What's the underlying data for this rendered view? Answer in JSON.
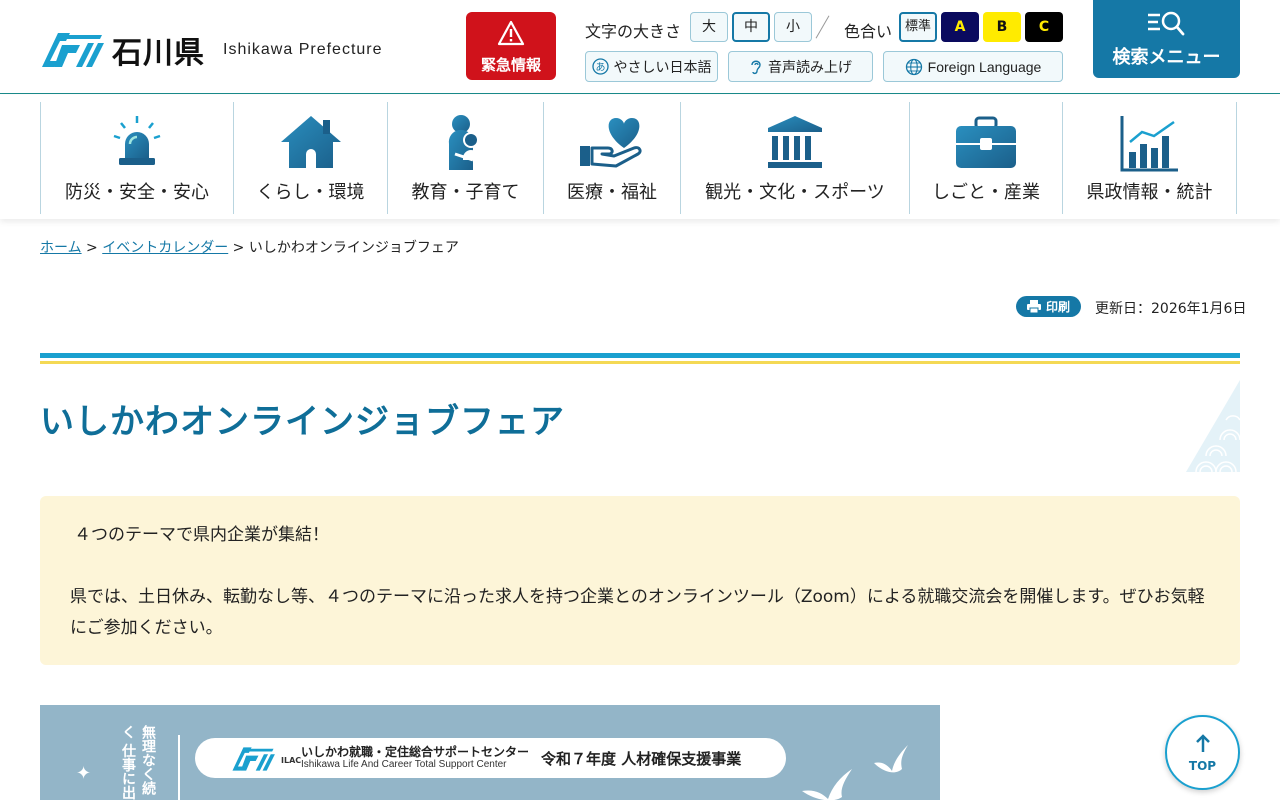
{
  "header": {
    "logo_jp": "石川県",
    "logo_en": "Ishikawa Prefecture",
    "emergency_label": "緊急情報",
    "text_size": {
      "label": "文字の大きさ",
      "large": "大",
      "medium": "中",
      "small": "小",
      "selected": "中"
    },
    "color": {
      "label": "色合い",
      "standard": "標準",
      "a": "A",
      "b": "B",
      "c": "C",
      "selected": "標準"
    },
    "easy_japanese": "やさしい日本語",
    "read_aloud": "音声読み上げ",
    "foreign_language": "Foreign Language",
    "search_menu": "検索メニュー"
  },
  "nav": {
    "items": [
      {
        "label": "防災・安全・安心",
        "icon": "siren-icon"
      },
      {
        "label": "くらし・環境",
        "icon": "house-icon"
      },
      {
        "label": "教育・子育て",
        "icon": "parent-child-icon"
      },
      {
        "label": "医療・福祉",
        "icon": "heart-hand-icon"
      },
      {
        "label": "観光・文化・スポーツ",
        "icon": "museum-icon"
      },
      {
        "label": "しごと・産業",
        "icon": "briefcase-icon"
      },
      {
        "label": "県政情報・統計",
        "icon": "bar-chart-icon"
      }
    ]
  },
  "breadcrumb": {
    "home": "ホーム",
    "sep1": " > ",
    "calendar": "イベントカレンダー",
    "sep2": " > ",
    "current": "いしかわオンラインジョブフェア"
  },
  "print_label": "印刷",
  "updated": "更新日：2026年1月6日",
  "page_title": "いしかわオンラインジョブフェア",
  "intro": {
    "line1": "４つのテーマで県内企業が集結！",
    "line2": "県では、土日休み、転勤なし等、４つのテーマに沿った求人を持つ企業とのオンラインツール（Zoom）による就職交流会を開催します。ぜひお気軽にご参加ください。"
  },
  "banner": {
    "side_text": "無理なく続く 仕事に出",
    "ilac": "ILAC",
    "center_jp": "いしかわ就職・定住総合サポートセンター",
    "center_en": "Ishikawa Life And Career Total Support Center",
    "project": "令和７年度 人材確保支援事業"
  },
  "top_button": "TOP",
  "colors": {
    "brand_blue": "#1578a6",
    "title_blue": "#0f6e98",
    "emergency_red": "#d0121b",
    "accent_yellow": "#f4d954",
    "intro_bg": "#fdf5d8"
  }
}
